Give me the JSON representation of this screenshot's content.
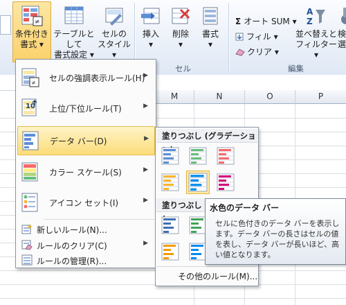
{
  "ribbon": {
    "conditional_format": {
      "line1": "条件付き",
      "line2": "書式 ▾"
    },
    "format_as_table": {
      "line1": "テーブルとして",
      "line2": "書式設定 ▾"
    },
    "cell_styles": {
      "line1": "セルの",
      "line2": "スタイル ▾"
    },
    "insert": {
      "line1": "挿入",
      "line2": "▾"
    },
    "delete": {
      "line1": "削除",
      "line2": "▾"
    },
    "format": {
      "line1": "書式",
      "line2": "▾"
    },
    "cells_group": "セル",
    "autosum": "オート SUM ▾",
    "fill": "フィル ▾",
    "clear": "クリア ▾",
    "sort_filter": {
      "line1": "並べ替えと",
      "line2": "フィルター ▾"
    },
    "find_select": {
      "line1": "検",
      "line2": "選"
    },
    "editing_group": "編集",
    "sigma": "Σ"
  },
  "columns": [
    "M",
    "N",
    "O",
    "P"
  ],
  "menu": {
    "items": [
      {
        "label": "セルの強調表示ルール(H)",
        "arrow": "▶"
      },
      {
        "label": "上位/下位ルール(T)",
        "arrow": "▶"
      },
      {
        "label": "データ バー(D)",
        "arrow": "▶"
      },
      {
        "label": "カラー スケール(S)",
        "arrow": "▶"
      },
      {
        "label": "アイコン セット(I)",
        "arrow": "▶"
      }
    ],
    "small_items": [
      {
        "label": "新しいルール(N)...",
        "arrow": ""
      },
      {
        "label": "ルールのクリア(C)",
        "arrow": "▶"
      },
      {
        "label": "ルールの管理(R)...",
        "arrow": ""
      }
    ]
  },
  "submenu": {
    "gradient_header": "塗りつぶし (グラデーション)",
    "solid_header": "塗りつぶし (",
    "more_rules": "その他のルール(M)..."
  },
  "tooltip": {
    "title": "水色のデータ バー",
    "body": "セルに色付きのデータ バーを表示します。データ バーの長さはセルの値を表し、データ バーが長いほど、高い値となります。"
  },
  "colors": {
    "bar_blue": "#5b8ed6",
    "bar_green": "#63be7b",
    "bar_red": "#f8696b",
    "bar_orange": "#ffb628",
    "bar_lightblue": "#008aef",
    "bar_purple": "#d6007b",
    "highlight": "#fcdc7a"
  },
  "data_bars": {
    "gradient": [
      "blue",
      "green",
      "red",
      "orange",
      "lightblue",
      "purple"
    ],
    "solid": [
      "blue",
      "green",
      "orange"
    ]
  }
}
